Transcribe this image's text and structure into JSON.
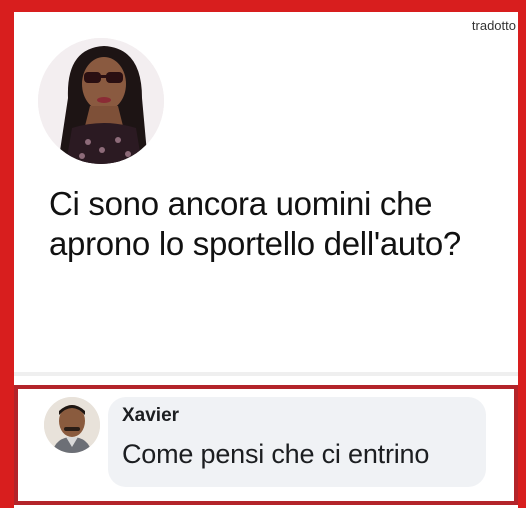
{
  "watermark": "tradotto",
  "post": {
    "text_line1": "Ci sono ancora uomini che",
    "text_line2": "aprono lo sportello dell'auto?"
  },
  "comment": {
    "author": "Xavier",
    "text": "Come pensi che ci entrino"
  },
  "colors": {
    "frame_red": "#d81e1e",
    "comment_outline": "#b3242a",
    "bubble_bg": "#f0f2f5"
  }
}
